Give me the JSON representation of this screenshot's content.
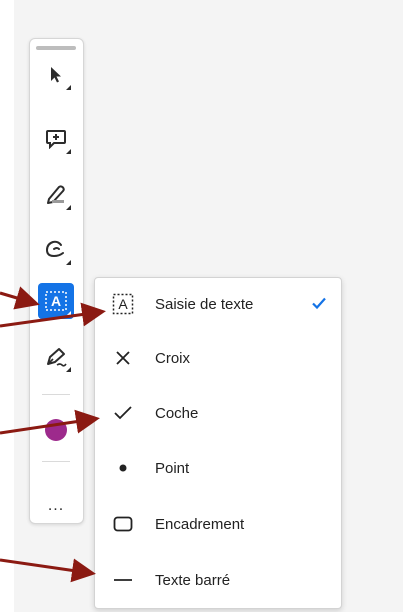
{
  "toolbar": {
    "tools": [
      {
        "name": "select-tool",
        "icon": "cursor-arrow-icon"
      },
      {
        "name": "comment-tool",
        "icon": "add-comment-icon"
      },
      {
        "name": "highlight-tool",
        "icon": "highlighter-icon"
      },
      {
        "name": "draw-tool",
        "icon": "freehand-draw-icon"
      },
      {
        "name": "text-entry-tool",
        "icon": "text-box-icon",
        "active": true
      },
      {
        "name": "signature-tool",
        "icon": "sign-pen-icon"
      }
    ],
    "color": "#9d2a8c",
    "more_label": "..."
  },
  "menu": {
    "items": [
      {
        "label": "Saisie de texte",
        "icon": "text-box-icon",
        "selected": true
      },
      {
        "label": "Croix",
        "icon": "cross-icon"
      },
      {
        "label": "Coche",
        "icon": "checkmark-icon"
      },
      {
        "label": "Point",
        "icon": "dot-icon"
      },
      {
        "label": "Encadrement",
        "icon": "rounded-rectangle-icon"
      },
      {
        "label": "Texte barré",
        "icon": "line-icon"
      }
    ]
  },
  "colors": {
    "accent": "#1473e6",
    "annotation_arrow": "#8b1a12"
  }
}
